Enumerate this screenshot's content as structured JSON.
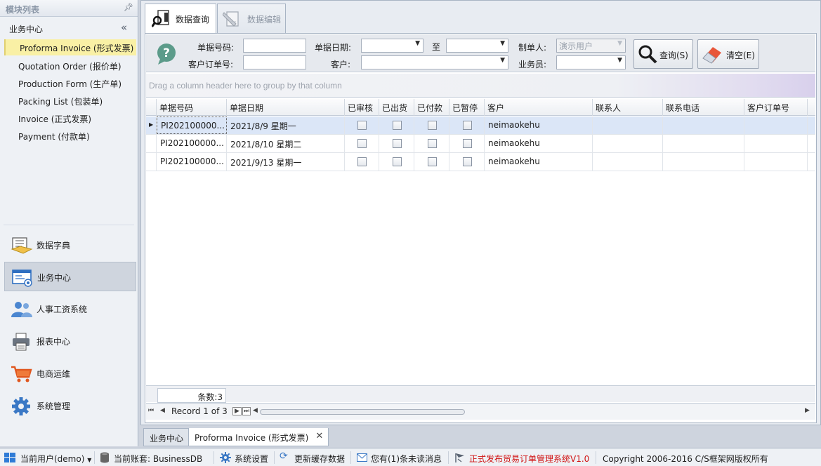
{
  "sidebar": {
    "title": "模块列表",
    "group_label": "业务中心",
    "items": [
      {
        "label": "Proforma Invoice (形式发票)"
      },
      {
        "label": "Quotation Order (报价单)"
      },
      {
        "label": "Production Form (生产单)"
      },
      {
        "label": "Packing List (包装单)"
      },
      {
        "label": "Invoice (正式发票)"
      },
      {
        "label": "Payment (付款单)"
      }
    ],
    "nav": [
      {
        "label": "数据字典",
        "icon": "dictionary-icon"
      },
      {
        "label": "业务中心",
        "icon": "business-center-icon"
      },
      {
        "label": "人事工资系统",
        "icon": "hr-icon"
      },
      {
        "label": "报表中心",
        "icon": "printer-icon"
      },
      {
        "label": "电商运维",
        "icon": "cart-icon"
      },
      {
        "label": "系统管理",
        "icon": "gear-icon"
      }
    ]
  },
  "tabs": {
    "query": "数据查询",
    "edit": "数据编辑"
  },
  "filter": {
    "doc_no_label": "单据号码:",
    "doc_date_label": "单据日期:",
    "to_label": "至",
    "maker_label": "制单人:",
    "maker_value": "演示用户",
    "cust_order_label": "客户订单号:",
    "customer_label": "客户:",
    "salesman_label": "业务员:",
    "query_button": "查询(S)",
    "clear_button": "清空(E)"
  },
  "grid": {
    "group_hint": "Drag a column header here to group by that column",
    "columns": [
      "单据号码",
      "单据日期",
      "已审核",
      "已出货",
      "已付款",
      "已暂停",
      "客户",
      "联系人",
      "联系电话",
      "客户订单号"
    ],
    "rows": [
      {
        "no": "PI202100000...",
        "date": "2021/8/9 星期一",
        "customer": "neimaokehu"
      },
      {
        "no": "PI202100000...",
        "date": "2021/8/10 星期二",
        "customer": "neimaokehu"
      },
      {
        "no": "PI202100000...",
        "date": "2021/9/13 星期一",
        "customer": "neimaokehu"
      }
    ],
    "count_text": "条数:3",
    "record_text": "Record 1 of 3"
  },
  "doc_tabs": {
    "first": "业务中心",
    "second": "Proforma Invoice (形式发票)"
  },
  "status": {
    "user": "当前用户(demo)",
    "account": "当前账套: BusinessDB",
    "settings": "系统设置",
    "refresh": "更新缓存数据",
    "messages": "您有(1)条未读消息",
    "release": "正式发布贸易订单管理系统V1.0",
    "copyright": "Copyright 2006-2016 C/S框架网版权所有"
  },
  "colors": {
    "accent_yellow": "#f9f0a5",
    "selected_row": "#dbe6f7",
    "release_red": "#d01010"
  }
}
